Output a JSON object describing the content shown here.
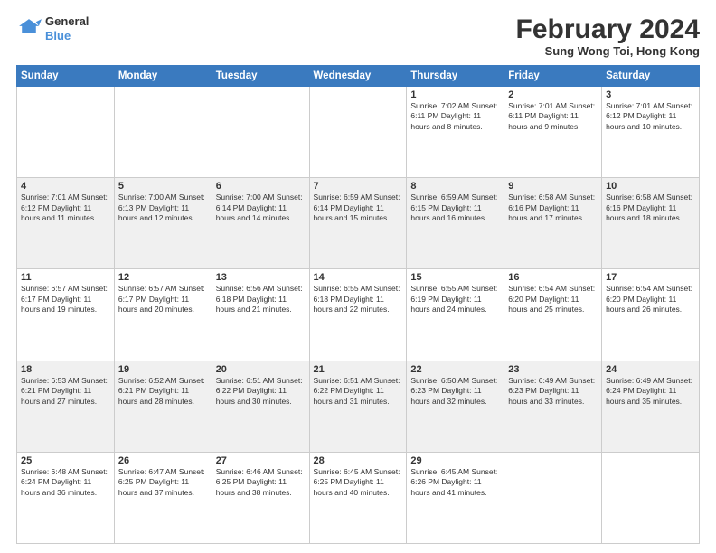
{
  "logo": {
    "line1": "General",
    "line2": "Blue"
  },
  "title": {
    "month_year": "February 2024",
    "location": "Sung Wong Toi, Hong Kong"
  },
  "headers": [
    "Sunday",
    "Monday",
    "Tuesday",
    "Wednesday",
    "Thursday",
    "Friday",
    "Saturday"
  ],
  "weeks": [
    [
      {
        "day": "",
        "info": ""
      },
      {
        "day": "",
        "info": ""
      },
      {
        "day": "",
        "info": ""
      },
      {
        "day": "",
        "info": ""
      },
      {
        "day": "1",
        "info": "Sunrise: 7:02 AM\nSunset: 6:11 PM\nDaylight: 11 hours and 8 minutes."
      },
      {
        "day": "2",
        "info": "Sunrise: 7:01 AM\nSunset: 6:11 PM\nDaylight: 11 hours and 9 minutes."
      },
      {
        "day": "3",
        "info": "Sunrise: 7:01 AM\nSunset: 6:12 PM\nDaylight: 11 hours and 10 minutes."
      }
    ],
    [
      {
        "day": "4",
        "info": "Sunrise: 7:01 AM\nSunset: 6:12 PM\nDaylight: 11 hours and 11 minutes."
      },
      {
        "day": "5",
        "info": "Sunrise: 7:00 AM\nSunset: 6:13 PM\nDaylight: 11 hours and 12 minutes."
      },
      {
        "day": "6",
        "info": "Sunrise: 7:00 AM\nSunset: 6:14 PM\nDaylight: 11 hours and 14 minutes."
      },
      {
        "day": "7",
        "info": "Sunrise: 6:59 AM\nSunset: 6:14 PM\nDaylight: 11 hours and 15 minutes."
      },
      {
        "day": "8",
        "info": "Sunrise: 6:59 AM\nSunset: 6:15 PM\nDaylight: 11 hours and 16 minutes."
      },
      {
        "day": "9",
        "info": "Sunrise: 6:58 AM\nSunset: 6:16 PM\nDaylight: 11 hours and 17 minutes."
      },
      {
        "day": "10",
        "info": "Sunrise: 6:58 AM\nSunset: 6:16 PM\nDaylight: 11 hours and 18 minutes."
      }
    ],
    [
      {
        "day": "11",
        "info": "Sunrise: 6:57 AM\nSunset: 6:17 PM\nDaylight: 11 hours and 19 minutes."
      },
      {
        "day": "12",
        "info": "Sunrise: 6:57 AM\nSunset: 6:17 PM\nDaylight: 11 hours and 20 minutes."
      },
      {
        "day": "13",
        "info": "Sunrise: 6:56 AM\nSunset: 6:18 PM\nDaylight: 11 hours and 21 minutes."
      },
      {
        "day": "14",
        "info": "Sunrise: 6:55 AM\nSunset: 6:18 PM\nDaylight: 11 hours and 22 minutes."
      },
      {
        "day": "15",
        "info": "Sunrise: 6:55 AM\nSunset: 6:19 PM\nDaylight: 11 hours and 24 minutes."
      },
      {
        "day": "16",
        "info": "Sunrise: 6:54 AM\nSunset: 6:20 PM\nDaylight: 11 hours and 25 minutes."
      },
      {
        "day": "17",
        "info": "Sunrise: 6:54 AM\nSunset: 6:20 PM\nDaylight: 11 hours and 26 minutes."
      }
    ],
    [
      {
        "day": "18",
        "info": "Sunrise: 6:53 AM\nSunset: 6:21 PM\nDaylight: 11 hours and 27 minutes."
      },
      {
        "day": "19",
        "info": "Sunrise: 6:52 AM\nSunset: 6:21 PM\nDaylight: 11 hours and 28 minutes."
      },
      {
        "day": "20",
        "info": "Sunrise: 6:51 AM\nSunset: 6:22 PM\nDaylight: 11 hours and 30 minutes."
      },
      {
        "day": "21",
        "info": "Sunrise: 6:51 AM\nSunset: 6:22 PM\nDaylight: 11 hours and 31 minutes."
      },
      {
        "day": "22",
        "info": "Sunrise: 6:50 AM\nSunset: 6:23 PM\nDaylight: 11 hours and 32 minutes."
      },
      {
        "day": "23",
        "info": "Sunrise: 6:49 AM\nSunset: 6:23 PM\nDaylight: 11 hours and 33 minutes."
      },
      {
        "day": "24",
        "info": "Sunrise: 6:49 AM\nSunset: 6:24 PM\nDaylight: 11 hours and 35 minutes."
      }
    ],
    [
      {
        "day": "25",
        "info": "Sunrise: 6:48 AM\nSunset: 6:24 PM\nDaylight: 11 hours and 36 minutes."
      },
      {
        "day": "26",
        "info": "Sunrise: 6:47 AM\nSunset: 6:25 PM\nDaylight: 11 hours and 37 minutes."
      },
      {
        "day": "27",
        "info": "Sunrise: 6:46 AM\nSunset: 6:25 PM\nDaylight: 11 hours and 38 minutes."
      },
      {
        "day": "28",
        "info": "Sunrise: 6:45 AM\nSunset: 6:25 PM\nDaylight: 11 hours and 40 minutes."
      },
      {
        "day": "29",
        "info": "Sunrise: 6:45 AM\nSunset: 6:26 PM\nDaylight: 11 hours and 41 minutes."
      },
      {
        "day": "",
        "info": ""
      },
      {
        "day": "",
        "info": ""
      }
    ]
  ]
}
